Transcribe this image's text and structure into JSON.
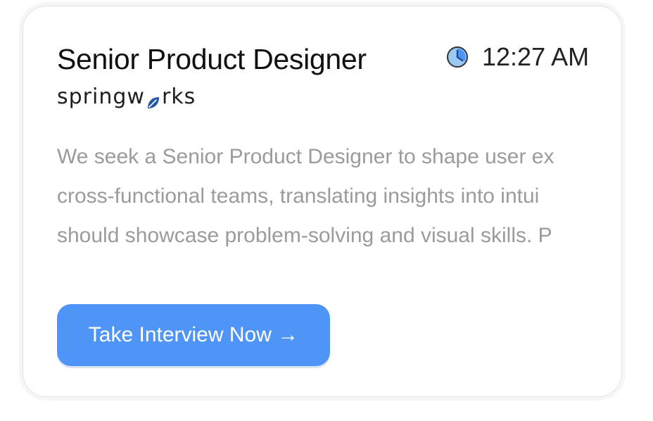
{
  "job_card": {
    "title": "Senior Product Designer",
    "company": {
      "logo_text_before": "springw",
      "logo_text_after": "rks",
      "logo_icon": "leaf-icon"
    },
    "time": {
      "icon": "clock-icon",
      "value": "12:27 AM"
    },
    "description_lines": [
      "We seek a Senior Product Designer to shape user ex",
      "cross-functional teams, translating insights into intui",
      "should showcase problem-solving and visual skills. P"
    ],
    "cta": {
      "label": "Take Interview Now →"
    }
  },
  "colors": {
    "accent": "#4f95f8",
    "title_text": "#111111",
    "description_text": "#9b9b9b",
    "logo_leaf": "#2456a6"
  }
}
